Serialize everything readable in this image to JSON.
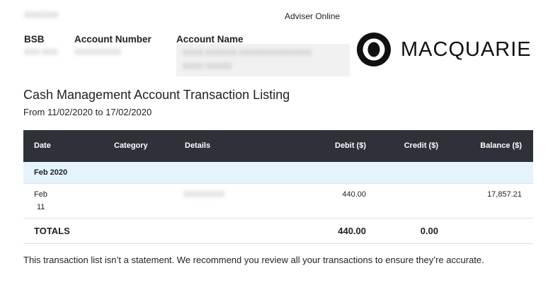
{
  "header": {
    "top_left_redacted": "XXXXXX",
    "app_title": "Adviser Online"
  },
  "account": {
    "bsb_label": "BSB",
    "bsb_value": "XXX-XXX",
    "number_label": "Account Number",
    "number_value": "XXXXXXXXX",
    "name_label": "Account Name",
    "name_line1": "XXXX XXXXXX XXXXXXXXXXXXXX",
    "name_line2": "XXXX XXXXX"
  },
  "logo": {
    "text": "MACQUARIE"
  },
  "report": {
    "title": "Cash Management Account Transaction Listing",
    "date_range": "From 11/02/2020 to 17/02/2020"
  },
  "table": {
    "columns": {
      "date": "Date",
      "category": "Category",
      "details": "Details",
      "debit": "Debit ($)",
      "credit": "Credit ($)",
      "balance": "Balance ($)"
    },
    "group_label": "Feb 2020",
    "rows": [
      {
        "date_month": "Feb",
        "date_day": "11",
        "category": "",
        "details": "XXXXXXXX",
        "debit": "440.00",
        "credit": "",
        "balance": "17,857.21"
      }
    ],
    "totals": {
      "label": "TOTALS",
      "debit": "440.00",
      "credit": "0.00"
    }
  },
  "footer": {
    "disclaimer": "This transaction list isn’t a statement. We recommend you review all your transactions to ensure they’re accurate."
  },
  "colors": {
    "table_header_bg": "#2e3138",
    "group_row_bg": "#e4f3fc",
    "logo": "#111111"
  }
}
